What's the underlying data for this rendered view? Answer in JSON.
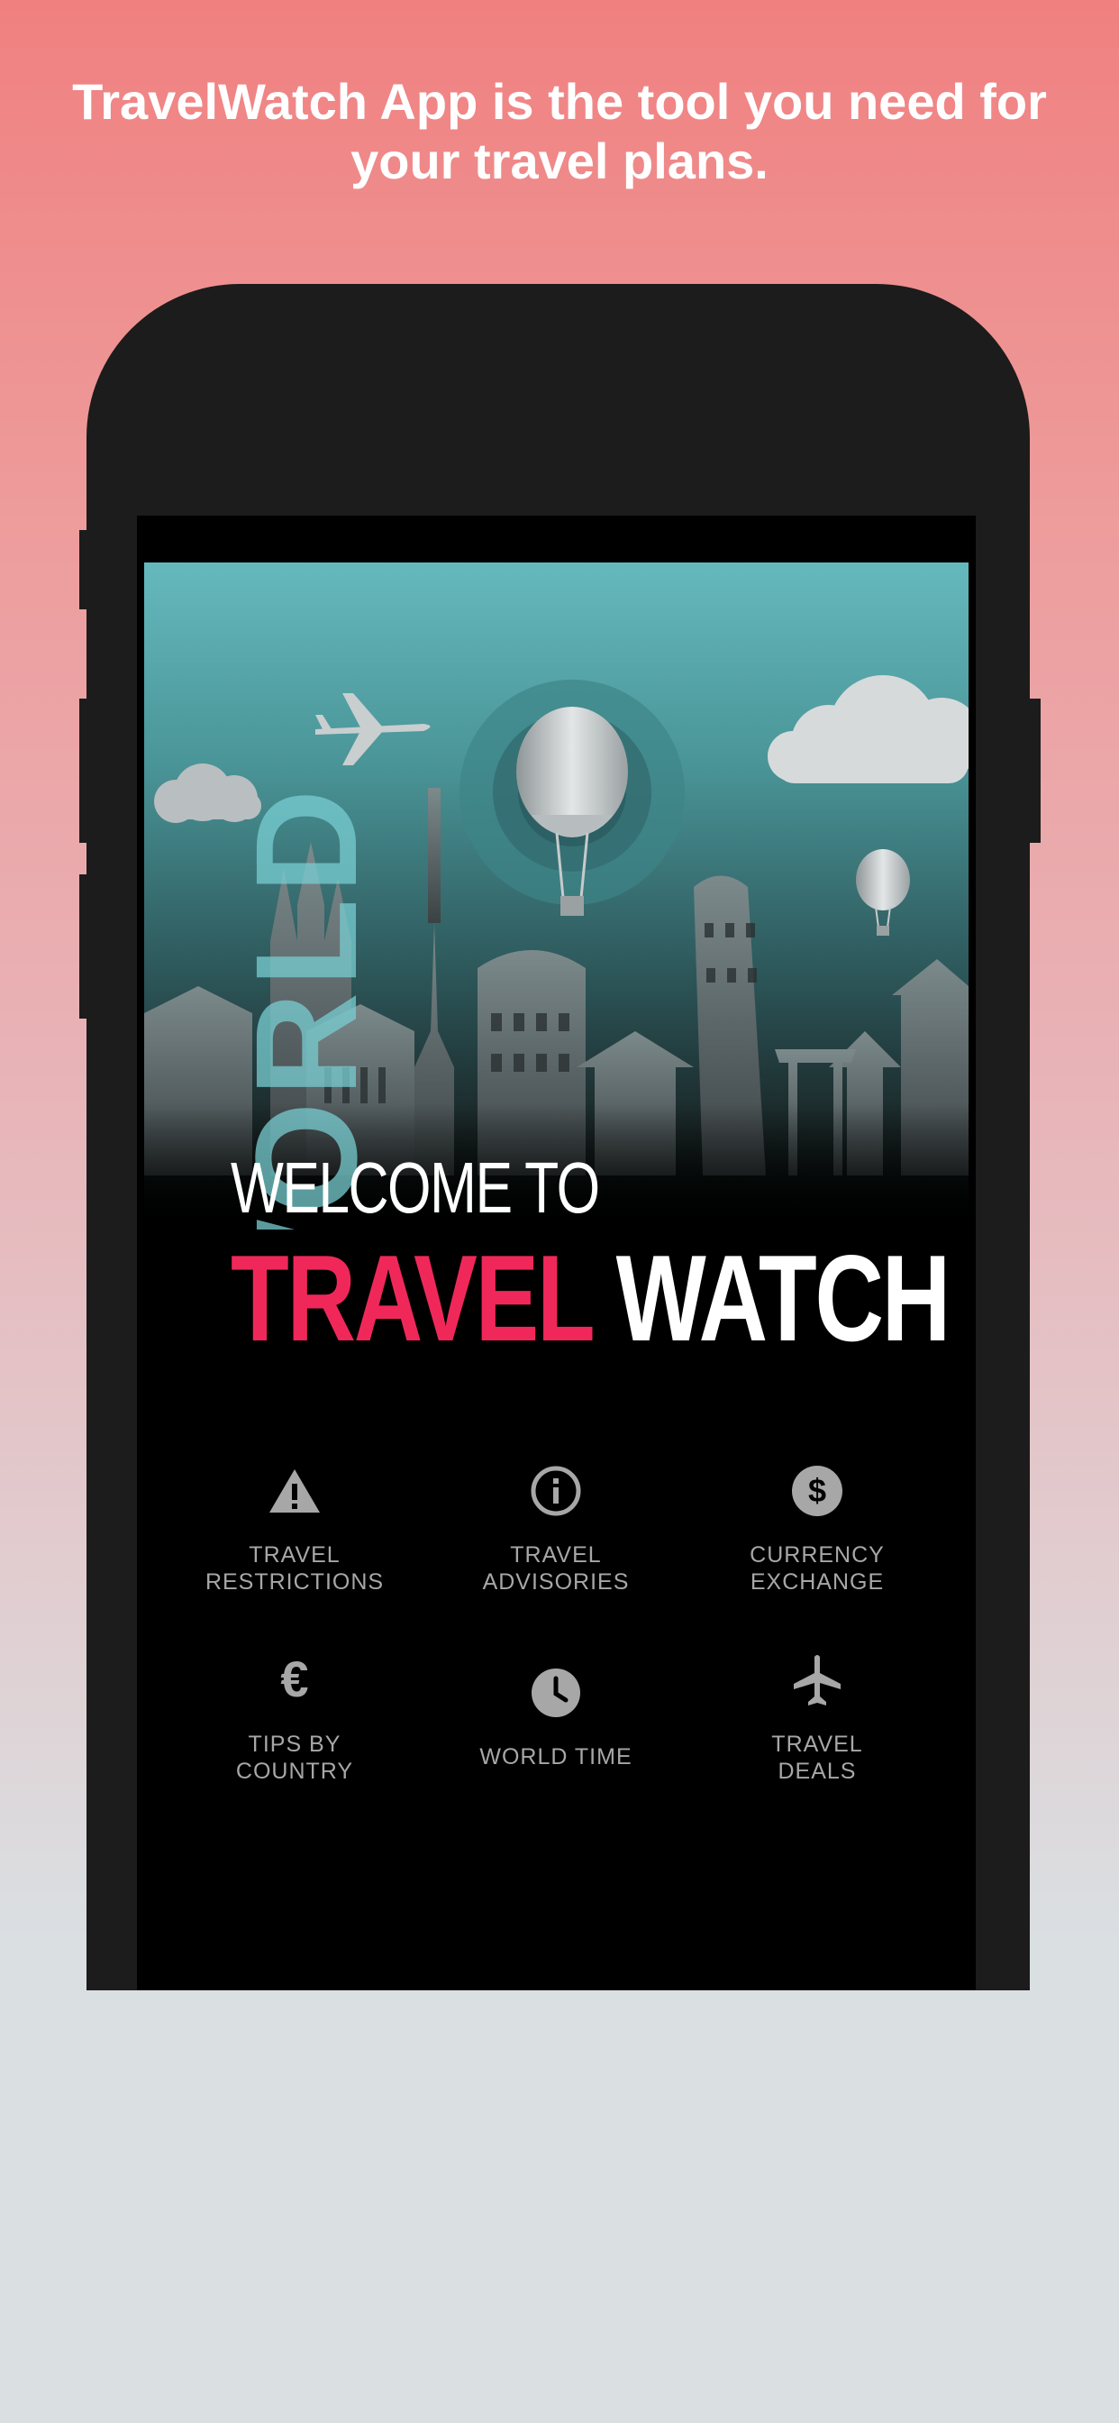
{
  "headline": "TravelWatch App is the tool you need for your travel plans.",
  "hero": {
    "vertical_word": "WORLD"
  },
  "welcome_label": "WELCOME TO",
  "brand": {
    "accent": "TRAVEL",
    "plain": "WATCH"
  },
  "colors": {
    "accent": "#f0285a",
    "icon_gray": "#a7a7a7"
  },
  "features": [
    {
      "label": "TRAVEL\nRESTRICTIONS",
      "icon": "warning-icon"
    },
    {
      "label": "TRAVEL\nADVISORIES",
      "icon": "info-icon"
    },
    {
      "label": "CURRENCY\nEXCHANGE",
      "icon": "dollar-icon"
    },
    {
      "label": "TIPS BY\nCOUNTRY",
      "icon": "euro-icon"
    },
    {
      "label": "WORLD TIME",
      "icon": "clock-icon"
    },
    {
      "label": "TRAVEL\nDEALS",
      "icon": "airplane-icon"
    }
  ]
}
